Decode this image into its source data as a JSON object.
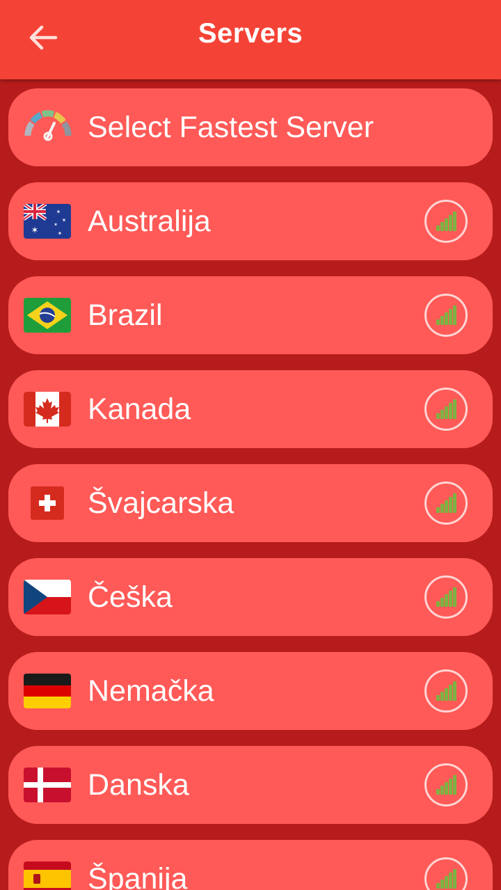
{
  "appbar": {
    "title": "Servers"
  },
  "fastest": {
    "label": "Select Fastest Server"
  },
  "servers": [
    {
      "label": "Australija",
      "flag": "australia-flag"
    },
    {
      "label": "Brazil",
      "flag": "brazil-flag"
    },
    {
      "label": "Kanada",
      "flag": "canada-flag"
    },
    {
      "label": "Švajcarska",
      "flag": "switzerland-flag"
    },
    {
      "label": "Češka",
      "flag": "czech-flag"
    },
    {
      "label": "Nemačka",
      "flag": "germany-flag"
    },
    {
      "label": "Danska",
      "flag": "denmark-flag"
    },
    {
      "label": "Španija",
      "flag": "spain-flag"
    }
  ],
  "colors": {
    "appbar": "#f44336",
    "background": "#b71c1c",
    "item": "#ff5a57",
    "signal_bars": "#7cb342"
  }
}
